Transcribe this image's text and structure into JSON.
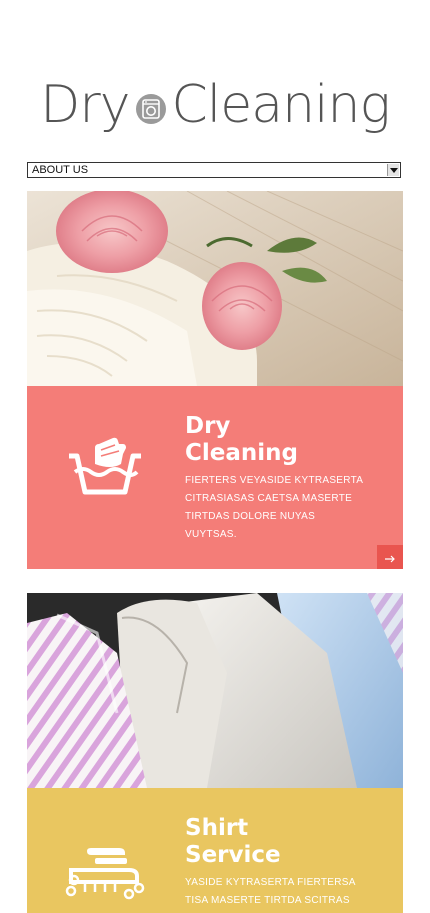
{
  "logo": {
    "part1": "Dry",
    "part2": "Cleaning",
    "badge_icon": "washing-machine-icon"
  },
  "nav": {
    "selected": "ABOUT US"
  },
  "services": [
    {
      "title": "Dry\nCleaning",
      "description": "FIERTERS VEYASIDE KYTRASERTA CITRASIASAS CAETSA MASERTE TIRTDAS DOLORE NUYAS VUYTSAS.",
      "color": "#f47d78",
      "icon": "hand-wash-icon",
      "button_icon": "arrow-right-icon",
      "button_color": "#e9554f"
    },
    {
      "title": "Shirt\nService",
      "description": "YASIDE KYTRASERTA FIERTERSA TISA MASERTE TIRTDA SCITRAS",
      "color": "#e9c660",
      "icon": "iron-brush-icon"
    }
  ]
}
